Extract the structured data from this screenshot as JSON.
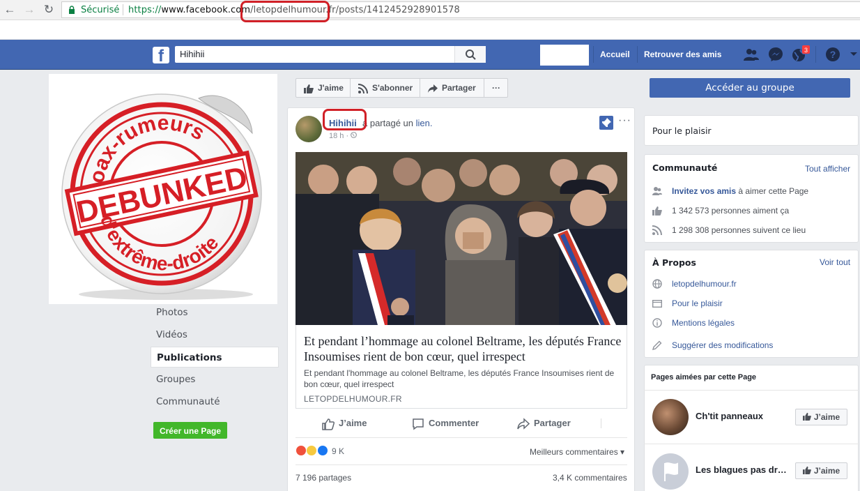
{
  "browser": {
    "secure_label": "Sécurisé",
    "url_proto": "https://",
    "url_host": "www.facebook.com",
    "url_path": "/letopdelhumour.fr/posts/1412452928901578"
  },
  "header": {
    "logo": "f",
    "search_value": "Hihihii",
    "home_label": "Accueil",
    "find_friends_label": "Retrouver des amis",
    "notif_count": "3"
  },
  "left": {
    "stamp": {
      "top": "Hoax-rumeurs",
      "middle": "DEBUNKED",
      "bottom": "d'extrême-droite"
    },
    "nav": [
      "Photos",
      "Vidéos",
      "Publications",
      "Groupes",
      "Communauté"
    ],
    "create_page_label": "Créer une Page"
  },
  "action_bar": {
    "like_label": "J'aime",
    "subscribe_label": "S'abonner",
    "share_label": "Partager",
    "more_label": "···",
    "join_group_label": "Accéder au groupe"
  },
  "post": {
    "author": "Hihihii",
    "action_prefix": "a partagé un",
    "action_link": "lien.",
    "time": "18 h · ",
    "link_title": "Et pendant l’hommage au colonel Beltrame, les députés France Insoumises rient de bon cœur, quel irrespect",
    "link_desc": "Et pendant l'hommage au colonel Beltrame, les députés France Insoumises rient de bon cœur, quel irrespect",
    "link_domain": "LETOPDELHUMOUR.FR",
    "actions": {
      "like": "J’aime",
      "comment": "Commenter",
      "share": "Partager"
    },
    "reaction_count": "9 K",
    "best_comments": "Meilleurs commentaires ▾",
    "shares": "7 196 partages",
    "comments": "3,4 K commentaires"
  },
  "right": {
    "plaisir": "Pour le plaisir",
    "community": {
      "title": "Communauté",
      "see_all": "Tout afficher",
      "invite_link": "Invitez vos amis",
      "invite_rest": " à aimer cette Page",
      "likes": "1 342 573 personnes aiment ça",
      "follows": "1 298 308 personnes suivent ce lieu"
    },
    "about": {
      "title": "À Propos",
      "see_all": "Voir tout",
      "website": "letopdelhumour.fr",
      "category": "Pour le plaisir",
      "legal": "Mentions légales",
      "suggest": "Suggérer des modifications"
    },
    "liked_pages": {
      "title": "Pages aimées par cette Page",
      "items": [
        {
          "name": "Ch'tit panneaux",
          "button": "J’aime"
        },
        {
          "name": "Les blagues pas dr…",
          "button": "J’aime"
        }
      ]
    }
  },
  "colors": {
    "fb_blue": "#4267b2",
    "link": "#365899",
    "annotation_red": "#d12027",
    "stamp_red": "#d61f26",
    "green": "#42b72a"
  }
}
